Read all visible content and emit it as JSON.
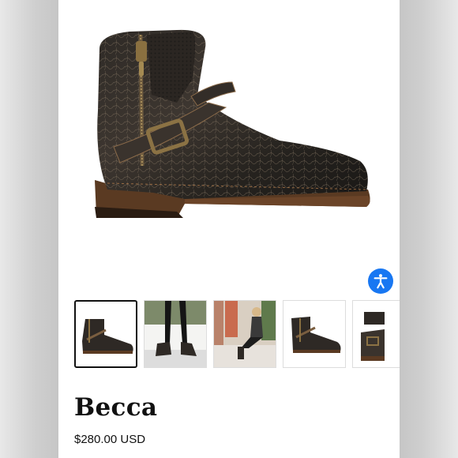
{
  "product": {
    "name": "Becca",
    "price": "$280.00 USD"
  },
  "hero_image": {
    "alt": "Distressed black leather ankle boot with side zipper and buckle strap"
  },
  "thumbnails": [
    {
      "label": "Boot side view",
      "selected": true
    },
    {
      "label": "Model wearing boots, legs"
    },
    {
      "label": "Model sitting outdoors in boots"
    },
    {
      "label": "Boot side view on white"
    },
    {
      "label": "Boot detail"
    }
  ],
  "accessibility_button": {
    "icon": "accessibility-icon",
    "color": "#1877f2"
  }
}
